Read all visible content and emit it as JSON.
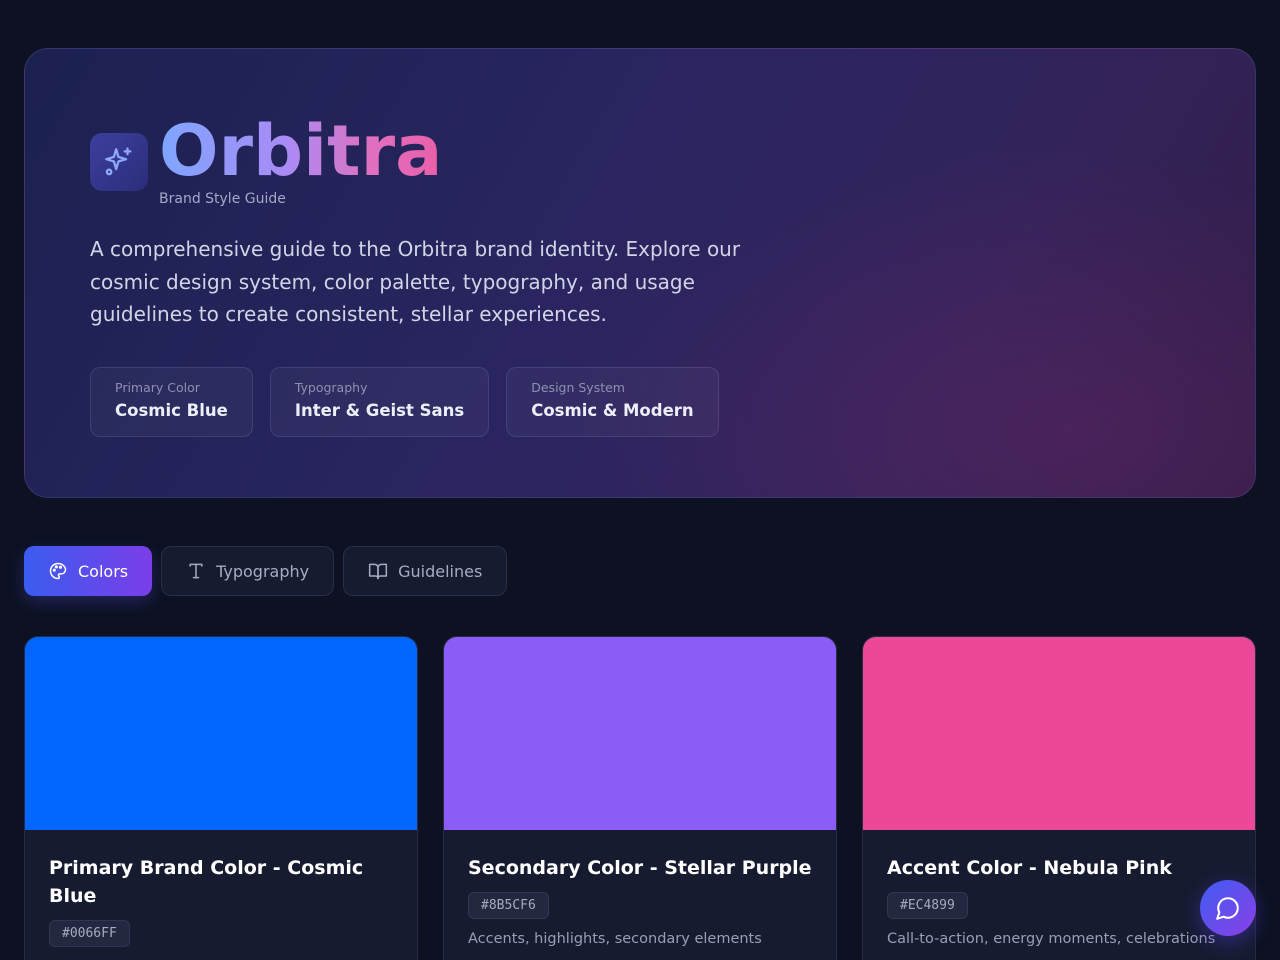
{
  "brand": {
    "name": "Orbitra",
    "subtitle": "Brand Style Guide",
    "logo_icon": "sparkles-icon",
    "description": "A comprehensive guide to the Orbitra brand identity. Explore our cosmic design system, color palette, typography, and usage guidelines to create consistent, stellar experiences."
  },
  "chips": [
    {
      "label": "Primary Color",
      "value": "Cosmic Blue"
    },
    {
      "label": "Typography",
      "value": "Inter & Geist Sans"
    },
    {
      "label": "Design System",
      "value": "Cosmic & Modern"
    }
  ],
  "tabs": [
    {
      "label": "Colors",
      "icon": "palette-icon",
      "active": true
    },
    {
      "label": "Typography",
      "icon": "type-icon",
      "active": false
    },
    {
      "label": "Guidelines",
      "icon": "book-open-icon",
      "active": false
    }
  ],
  "colors": [
    {
      "title": "Primary Brand Color - Cosmic Blue",
      "hex": "#0066FF",
      "swatch": "#0066FF",
      "usage": ""
    },
    {
      "title": "Secondary Color - Stellar Purple",
      "hex": "#8B5CF6",
      "swatch": "#8B5CF6",
      "usage": "Accents, highlights, secondary elements"
    },
    {
      "title": "Accent Color - Nebula Pink",
      "hex": "#EC4899",
      "swatch": "#EC4899",
      "usage": "Call-to-action, energy moments, celebrations"
    }
  ],
  "chat_button": {
    "icon": "chat-bubble-icon"
  },
  "theme": {
    "background": "#0d1122",
    "tab_active_start": "#3b5cf0",
    "tab_active_end": "#7b3ee8"
  }
}
